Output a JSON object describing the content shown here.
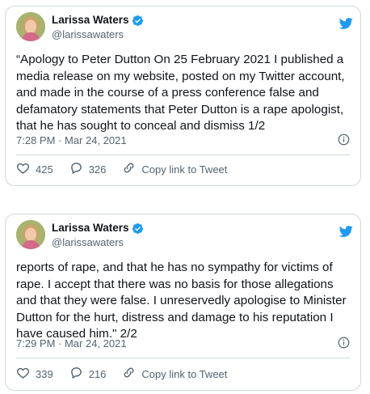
{
  "tweets": [
    {
      "name": "Larissa Waters",
      "handle": "@larissawaters",
      "text": "“Apology to Peter Dutton On 25 February 2021 I published a media release on my website, posted on my Twitter account, and made in the course of a press conference false and defamatory statements that Peter Dutton is a rape apologist, that he has sought to conceal and dismiss 1/2",
      "timestamp": "7:28 PM · Mar 24, 2021",
      "likes": "425",
      "replies": "326",
      "copy_link_label": "Copy link to Tweet"
    },
    {
      "name": "Larissa Waters",
      "handle": "@larissawaters",
      "text": "reports of rape, and that he has no sympathy for victims of rape. I accept that there was no basis for those allegations and that they were false. I unreservedly apologise to Minister Dutton for the hurt, distress and damage to his reputation I have caused him.\" 2/2",
      "timestamp": "7:29 PM · Mar 24, 2021",
      "likes": "339",
      "replies": "216",
      "copy_link_label": "Copy link to Tweet"
    }
  ],
  "colors": {
    "accent": "#1d9bf0",
    "muted": "#536471",
    "border": "#cfd9de"
  },
  "icons": [
    "verified-badge-icon",
    "twitter-bird-icon",
    "info-icon",
    "heart-icon",
    "reply-icon",
    "link-icon"
  ]
}
